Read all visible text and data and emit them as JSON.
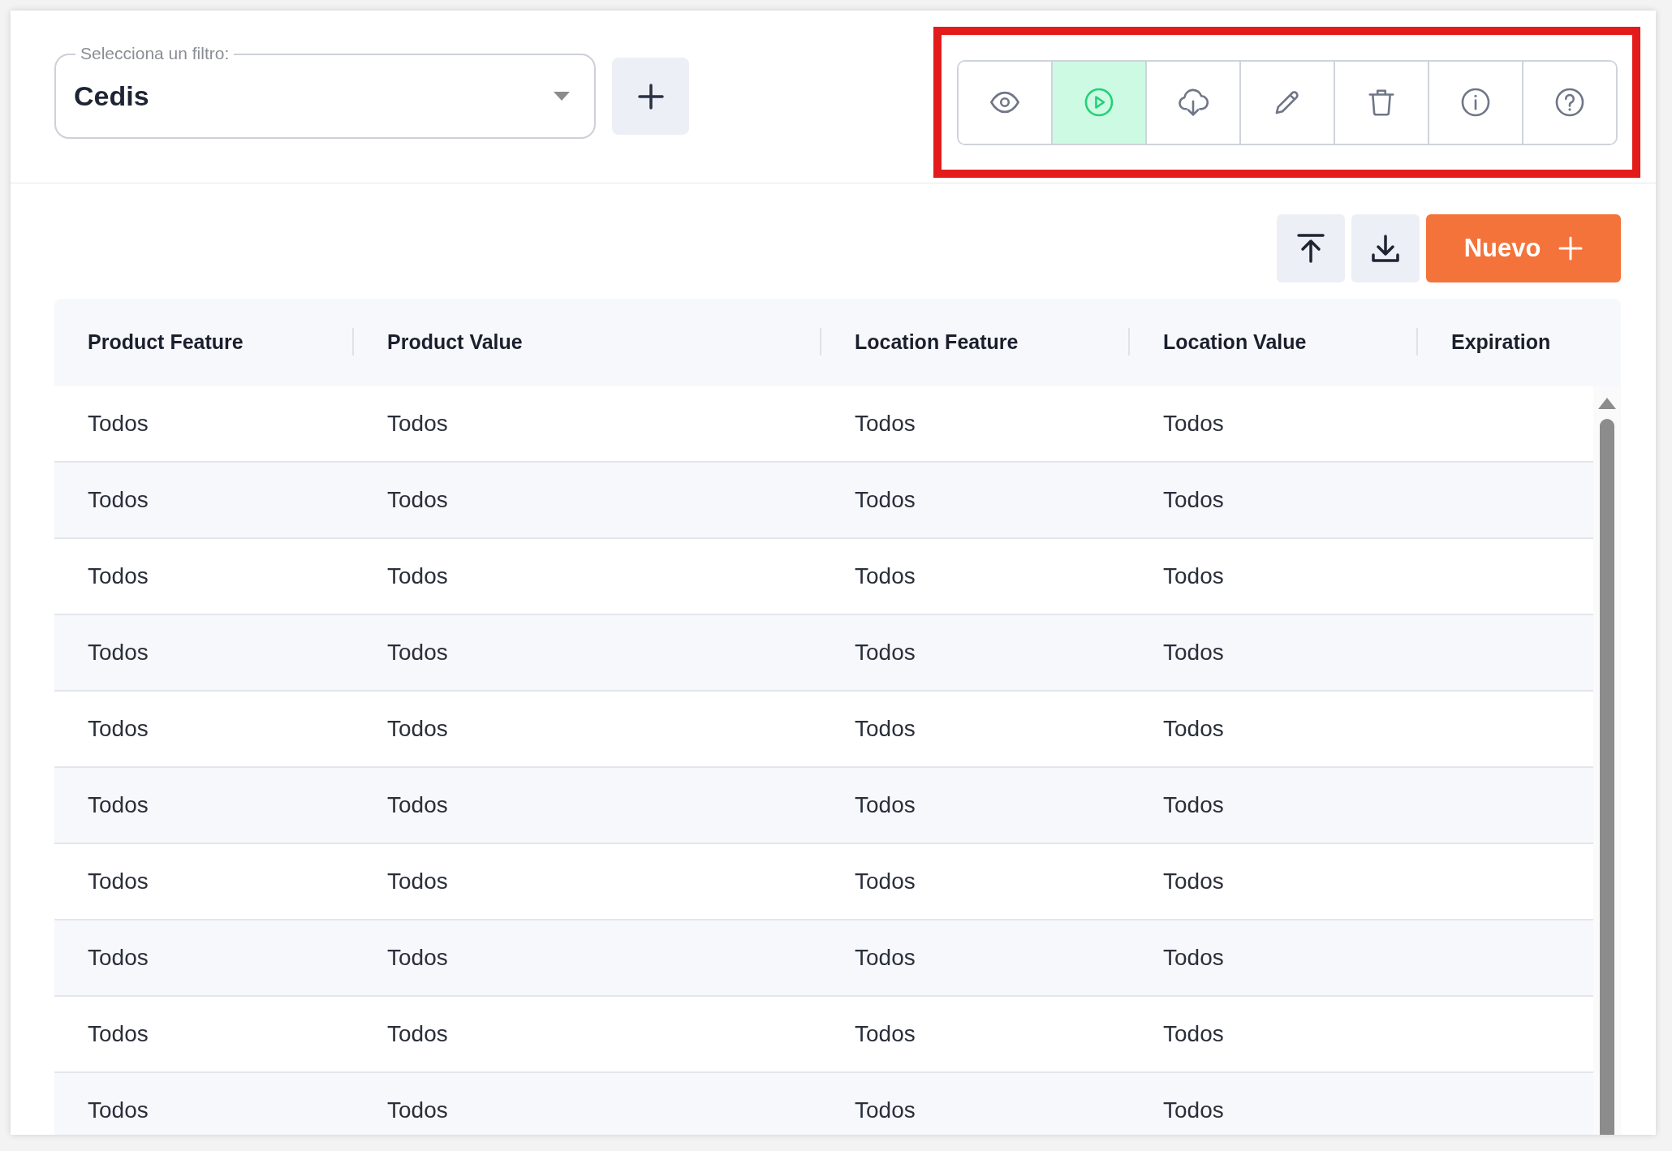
{
  "filter": {
    "label": "Selecciona un filtro:",
    "value": "Cedis"
  },
  "toolbar": [
    {
      "kind": "view",
      "selected": false
    },
    {
      "kind": "run",
      "selected": true
    },
    {
      "kind": "cloud-download",
      "selected": false
    },
    {
      "kind": "edit",
      "selected": false
    },
    {
      "kind": "delete",
      "selected": false
    },
    {
      "kind": "info",
      "selected": false
    },
    {
      "kind": "help",
      "selected": false
    }
  ],
  "actions": {
    "new_button": "Nuevo"
  },
  "table": {
    "columns": [
      "Product Feature",
      "Product Value",
      "Location Feature",
      "Location Value",
      "Expiration"
    ],
    "rows": [
      [
        "Todos",
        "Todos",
        "Todos",
        "Todos"
      ],
      [
        "Todos",
        "Todos",
        "Todos",
        "Todos"
      ],
      [
        "Todos",
        "Todos",
        "Todos",
        "Todos"
      ],
      [
        "Todos",
        "Todos",
        "Todos",
        "Todos"
      ],
      [
        "Todos",
        "Todos",
        "Todos",
        "Todos"
      ],
      [
        "Todos",
        "Todos",
        "Todos",
        "Todos"
      ],
      [
        "Todos",
        "Todos",
        "Todos",
        "Todos"
      ],
      [
        "Todos",
        "Todos",
        "Todos",
        "Todos"
      ],
      [
        "Todos",
        "Todos",
        "Todos",
        "Todos"
      ],
      [
        "Todos",
        "Todos",
        "Todos",
        "Todos"
      ]
    ]
  }
}
